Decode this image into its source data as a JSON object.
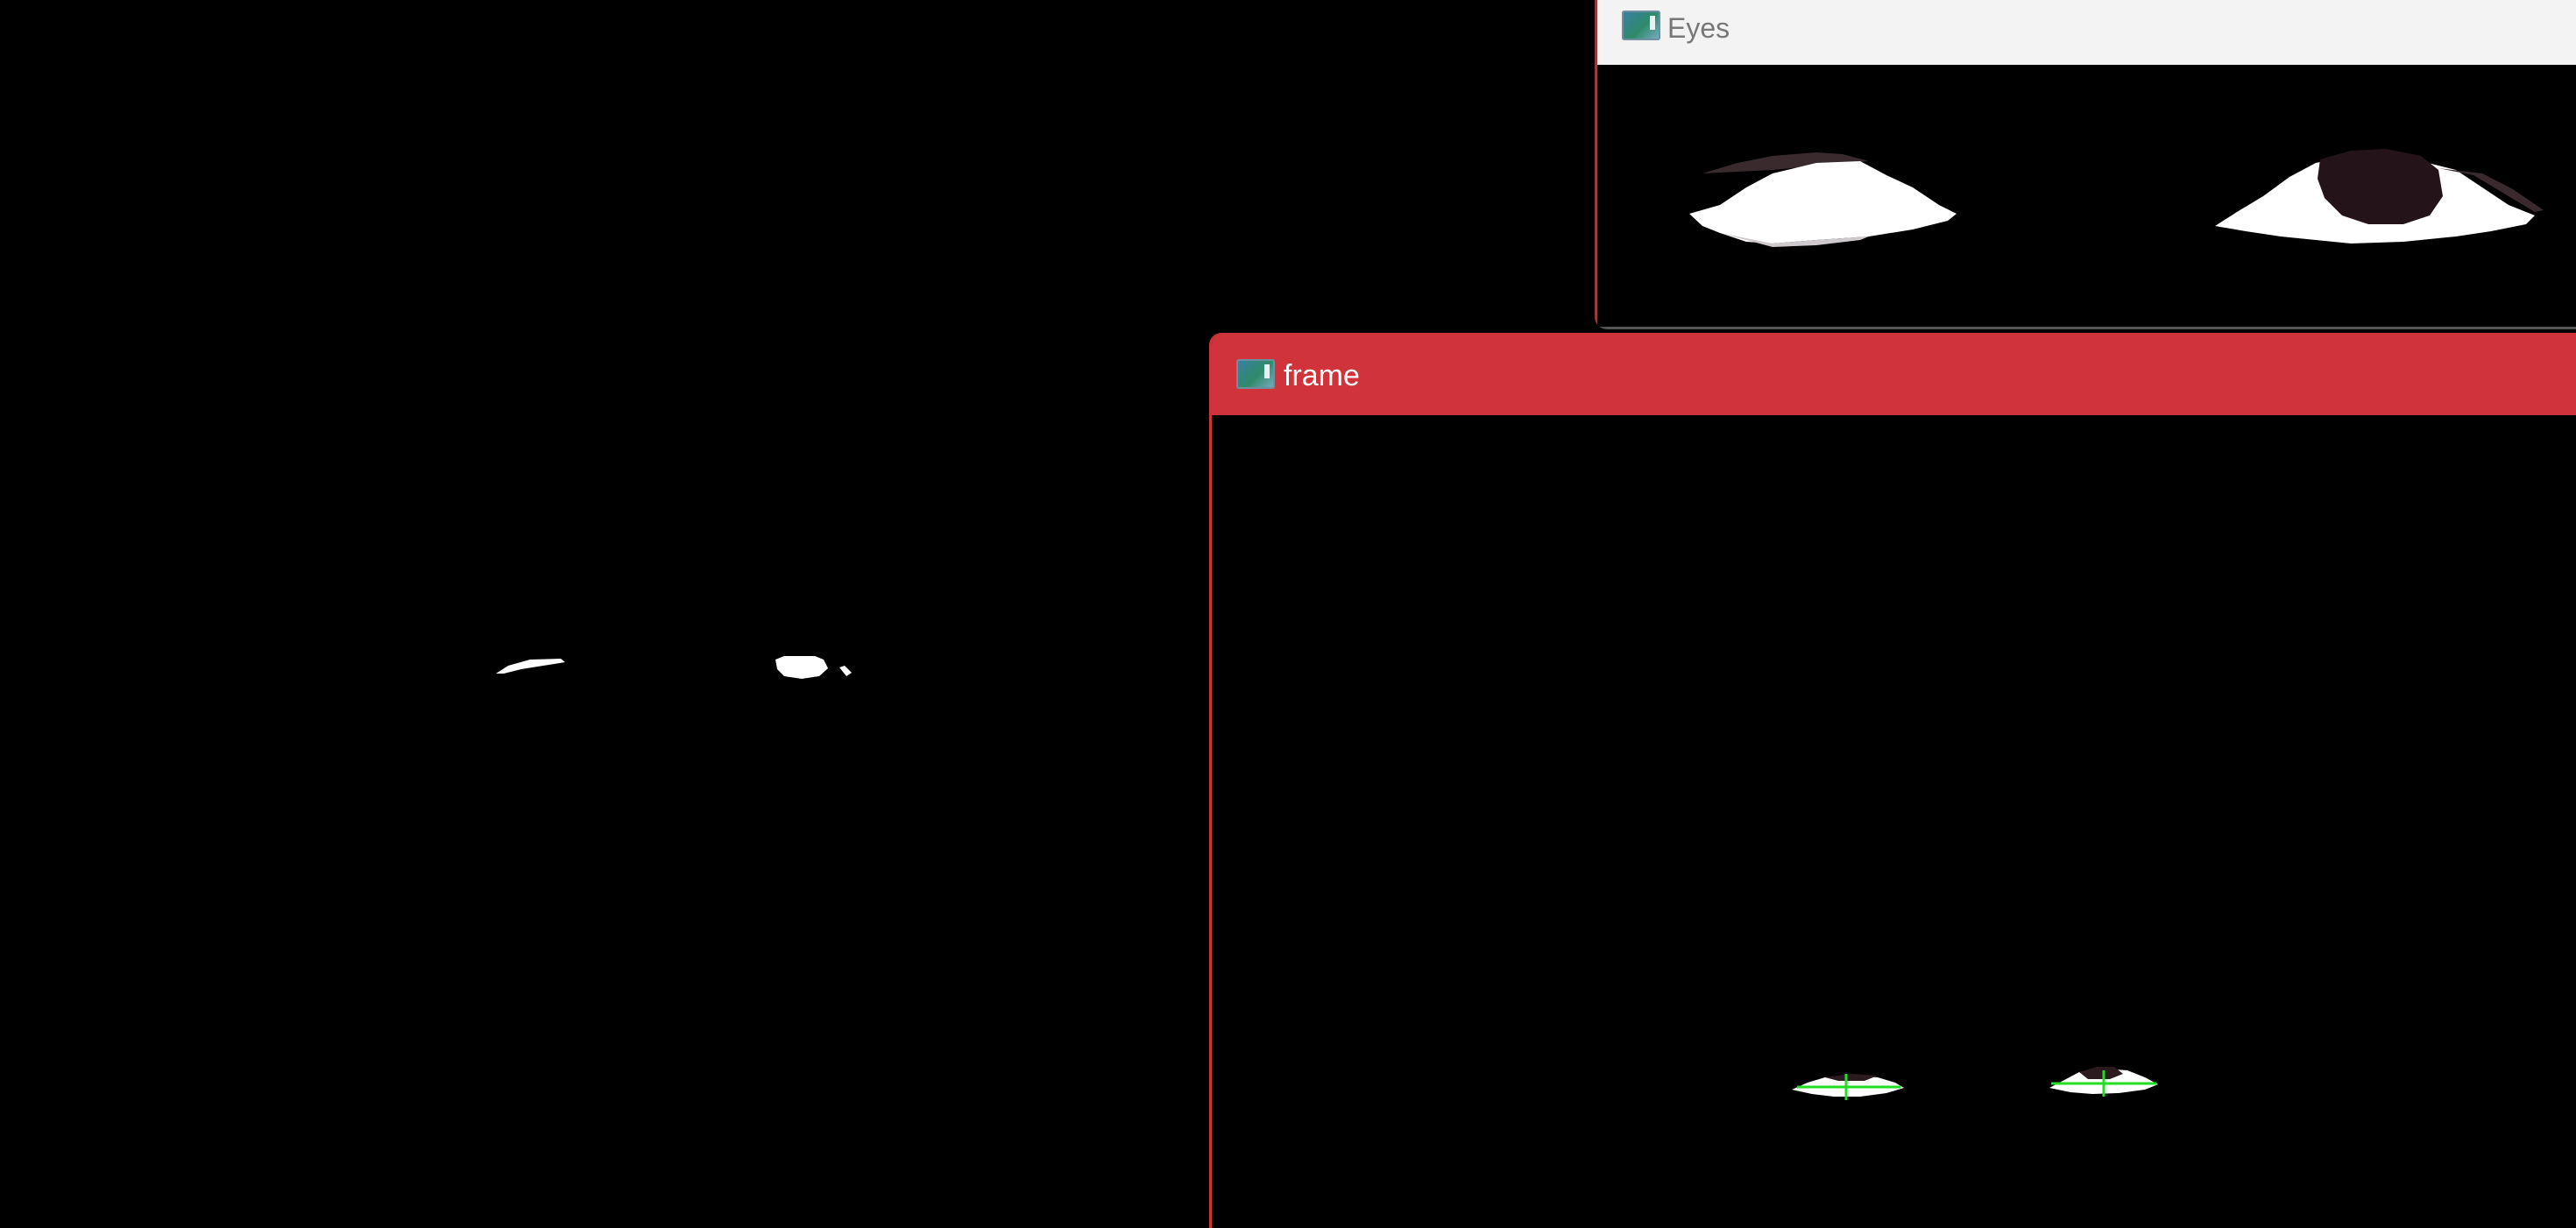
{
  "windows": {
    "eyes": {
      "title": "Eyes",
      "controls": {
        "minimize": "–",
        "maximize": "☐"
      }
    },
    "frame": {
      "title": "frame"
    }
  },
  "icons": {
    "app_icon": "opencv-window-icon",
    "minimize": "minimize-icon",
    "maximize": "maximize-icon"
  },
  "colors": {
    "frame_titlebar": "#d0343a",
    "eyes_titlebar": "#f3f3f3",
    "background": "#000000",
    "pupil_marker": "#22dd22"
  }
}
